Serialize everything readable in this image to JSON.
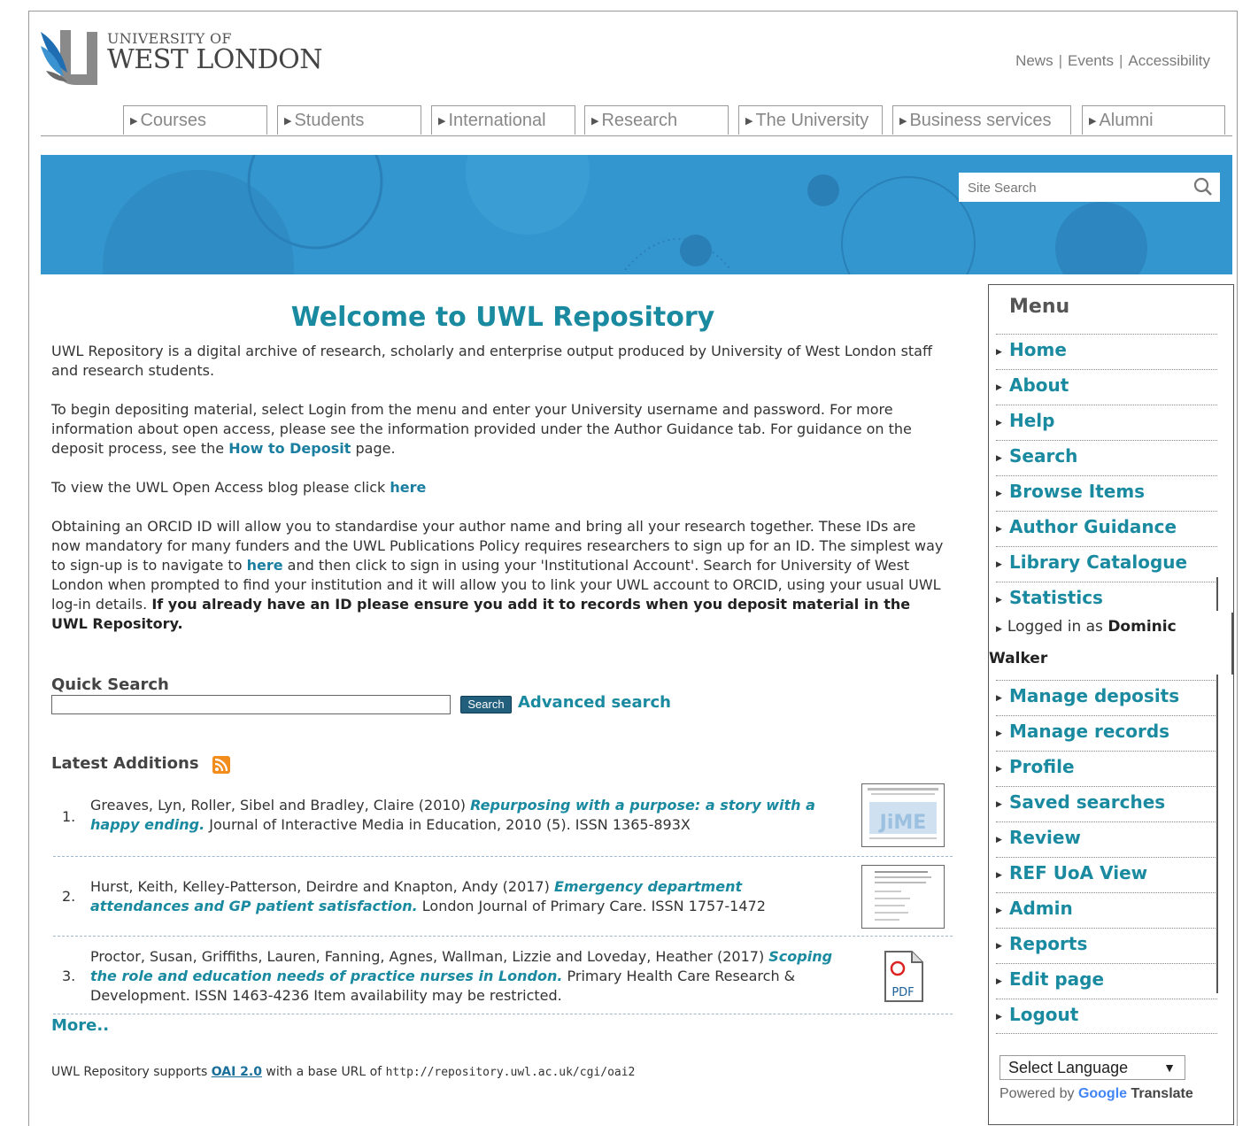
{
  "header": {
    "logo_small": "UNIVERSITY OF",
    "logo_big": "WEST LONDON",
    "top_links": [
      "News",
      "Events",
      "Accessibility"
    ]
  },
  "main_nav": [
    "Courses",
    "Students",
    "International",
    "Research",
    "The University",
    "Business services",
    "Alumni"
  ],
  "site_search": {
    "placeholder": "Site Search",
    "icon": "search-icon"
  },
  "colors": {
    "accent": "#1a8aa0",
    "banner": "#3496cf",
    "rss": "#f28c1b"
  },
  "content": {
    "title": "Welcome to UWL Repository",
    "p1": "UWL Repository is a digital archive of research, scholarly and enterprise output produced by University of West London staff and research students.",
    "p2_before": "To begin depositing material, select Login from the menu and enter your University username and password. For more information about open access, please see the information provided under the Author Guidance tab. For guidance on the deposit process, see the ",
    "p2_link": "How to Deposit",
    "p2_after": " page.",
    "p3_before": "To view the UWL Open Access blog please click ",
    "p3_link": "here",
    "p4_a": "Obtaining an ORCID ID will allow you to standardise your author name and bring all your research together. These IDs are now mandatory for many funders and the UWL Publications Policy requires researchers to sign up for an ID. The simplest way to sign-up is to navigate to ",
    "p4_link": "here",
    "p4_b": " and then click to sign in using your 'Institutional Account'. Search for University of West London when prompted to find your institution and it will allow you to link your UWL account to ORCID, using your usual UWL log-in details. ",
    "p4_bold": "If you already have an ID please ensure you add it to records when you deposit material in the UWL Repository."
  },
  "quick_search": {
    "label": "Quick Search",
    "value": "",
    "button": "Search",
    "advanced": "Advanced search"
  },
  "latest": {
    "heading": "Latest Additions",
    "items": [
      {
        "num": "1.",
        "authors": "Greaves, Lyn, Roller, Sibel and Bradley, Claire (2010) ",
        "title": "Repurposing with a purpose: a story with a happy ending.",
        "rest": " Journal of Interactive Media in Education, 2010 (5). ISSN 1365-893X"
      },
      {
        "num": "2.",
        "authors": "Hurst, Keith, Kelley-Patterson, Deirdre and Knapton, Andy (2017) ",
        "title": "Emergency department attendances and GP patient satisfaction.",
        "rest": " London Journal of Primary Care. ISSN 1757-1472"
      },
      {
        "num": "3.",
        "authors": "Proctor, Susan, Griffiths, Lauren, Fanning, Agnes, Wallman, Lizzie and Loveday, Heather (2017) ",
        "title": "Scoping the role and education needs of practice nurses in London.",
        "rest": " Primary Health Care Research & Development. ISSN 1463-4236 Item availability may be restricted.",
        "pdf_label": "PDF"
      }
    ],
    "more": "More..",
    "thumb1_text": "JiME"
  },
  "oai": {
    "before": "UWL Repository supports ",
    "link": "OAI 2.0",
    "middle": " with a base URL of ",
    "url": "http://repository.uwl.ac.uk/cgi/oai2"
  },
  "menu": {
    "title": "Menu",
    "items_top": [
      "Home",
      "About",
      "Help",
      "Search",
      "Browse Items",
      "Author Guidance",
      "Library Catalogue",
      "Statistics"
    ],
    "logged_prefix": "Logged in as ",
    "logged_user_first": "Dominic",
    "logged_user_last": "Walker",
    "items_bottom": [
      "Manage deposits",
      "Manage records",
      "Profile",
      "Saved searches",
      "Review",
      "REF UoA View",
      "Admin",
      "Reports",
      "Edit page",
      "Logout"
    ]
  },
  "translate": {
    "select_label": "Select Language",
    "powered_by": "Powered by ",
    "google": "Google",
    "translate": "Translate"
  }
}
